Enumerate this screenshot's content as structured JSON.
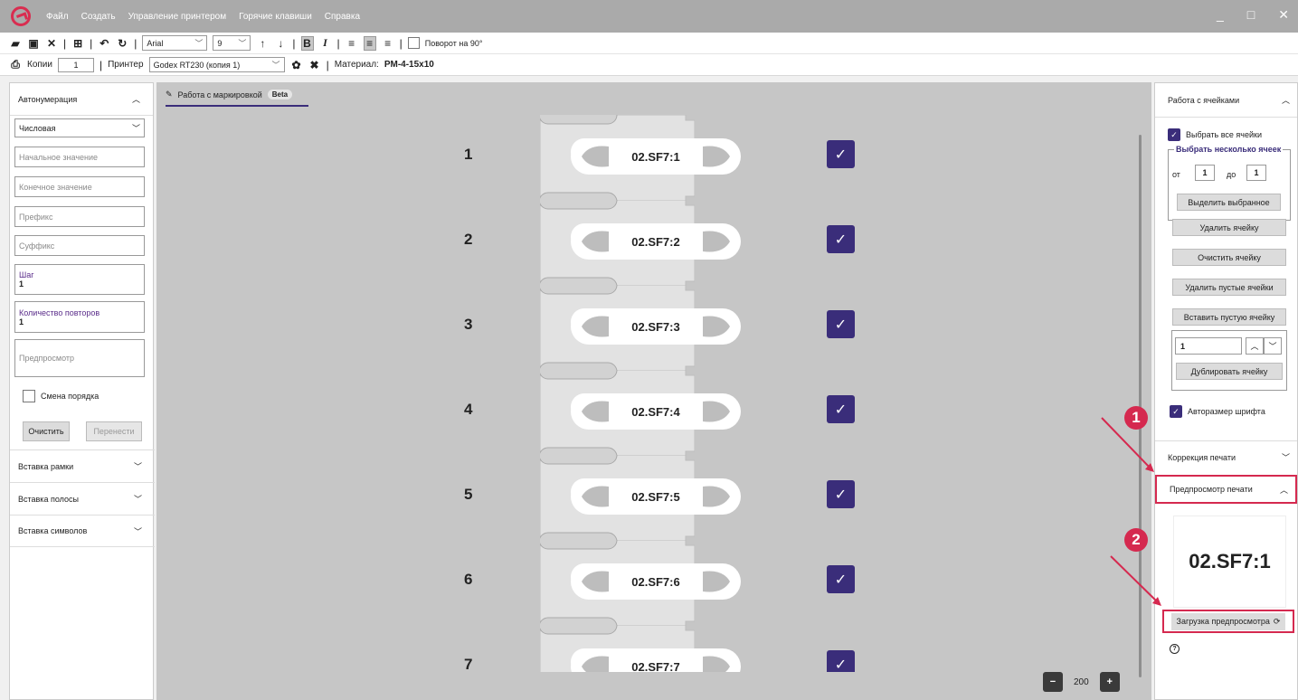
{
  "menu": [
    "Файл",
    "Создать",
    "Управление принтером",
    "Горячие клавиши",
    "Справка"
  ],
  "toolbar1": {
    "font": "Arial",
    "size": "9",
    "rotate_label": "Поворот на 90°"
  },
  "toolbar2": {
    "copies_label": "Копии",
    "copies_value": "1",
    "printer_label": "Принтер",
    "printer_value": "Godex RT230 (копия 1)",
    "material_label": "Материал:",
    "material_value": "PM-4-15x10"
  },
  "left_panel": {
    "header": "Автонумерация",
    "type_value": "Числовая",
    "start_placeholder": "Начальное значение",
    "end_placeholder": "Конечное значение",
    "prefix_placeholder": "Префикс",
    "suffix_placeholder": "Суффикс",
    "step_label": "Шаг",
    "step_value": "1",
    "repeat_label": "Количество повторов",
    "repeat_value": "1",
    "preview_placeholder": "Предпросмотр",
    "order_label": "Смена порядка",
    "clear_label": "Очистить",
    "transfer_label": "Перенести",
    "sections": [
      "Вставка рамки",
      "Вставка полосы",
      "Вставка символов"
    ]
  },
  "center": {
    "tab_label": "Работа с маркировкой",
    "beta_label": "Beta",
    "rows": [
      {
        "num": "1",
        "text": "02.SF7:1"
      },
      {
        "num": "2",
        "text": "02.SF7:2"
      },
      {
        "num": "3",
        "text": "02.SF7:3"
      },
      {
        "num": "4",
        "text": "02.SF7:4"
      },
      {
        "num": "5",
        "text": "02.SF7:5"
      },
      {
        "num": "6",
        "text": "02.SF7:6"
      },
      {
        "num": "7",
        "text": "02.SF7:7"
      }
    ],
    "zoom_value": "200"
  },
  "right_panel": {
    "header": "Работа с ячейками",
    "select_all": "Выбрать все ячейки",
    "select_several": "Выбрать несколько ячеек",
    "from_label": "от",
    "from_value": "1",
    "to_label": "до",
    "to_value": "1",
    "select_btn": "Выделить выбранное",
    "delete_cell": "Удалить ячейку",
    "clear_cell": "Очистить ячейку",
    "delete_empty": "Удалить пустые ячейки",
    "insert_empty": "Вставить пустую ячейку",
    "dup_value": "1",
    "dup_btn": "Дублировать ячейку",
    "autosize": "Авторазмер шрифта",
    "print_correction": "Коррекция печати",
    "print_preview": "Предпросмотр печати",
    "preview_text": "02.SF7:1",
    "load_preview": "Загрузка предпросмотра"
  },
  "annotations": [
    "1",
    "2"
  ],
  "colors": {
    "accent": "#3a2d7a",
    "highlight": "#d5294f",
    "titlebar": "#aaaaaa"
  }
}
